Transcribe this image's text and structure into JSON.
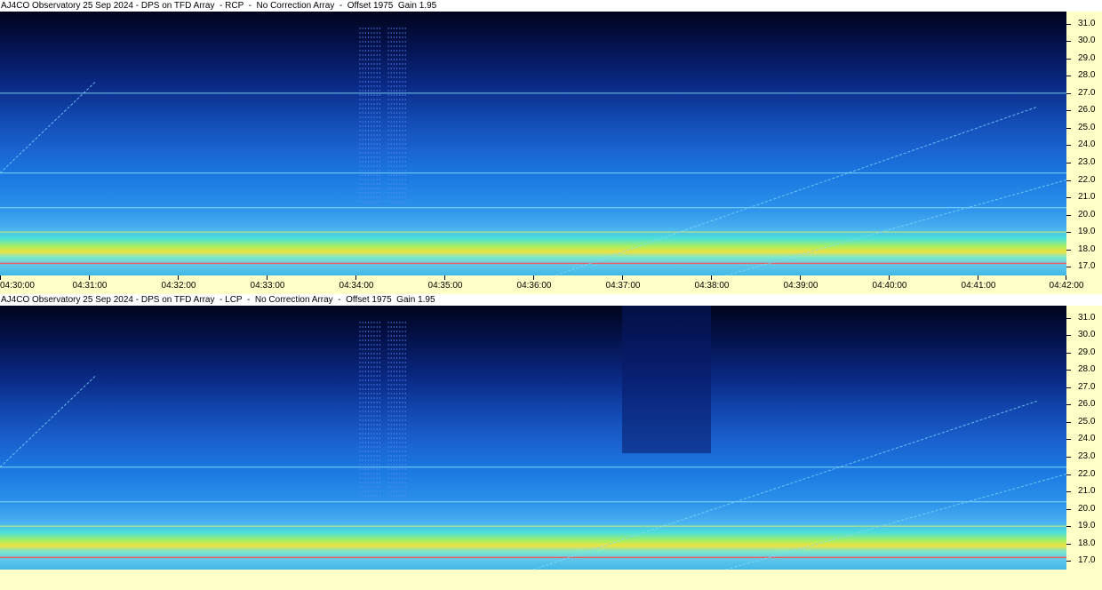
{
  "chart_data": [
    {
      "type": "heatmap",
      "title": "AJ4CO Observatory 25 Sep 2024 - DPS on TFD Array  - RCP  -  No Correction Array  -  Offset 1975  Gain 1.95",
      "polarization": "RCP",
      "xlabel": "",
      "ylabel": "",
      "x_ticks": [
        "04:30:00",
        "04:31:00",
        "04:32:00",
        "04:33:00",
        "04:34:00",
        "04:35:00",
        "04:36:00",
        "04:37:00",
        "04:38:00",
        "04:39:00",
        "04:40:00",
        "04:41:00",
        "04:42:00"
      ],
      "y_ticks": [
        "31.0",
        "30.0",
        "29.0",
        "28.0",
        "27.0",
        "26.0",
        "25.0",
        "24.0",
        "23.0",
        "22.0",
        "21.0",
        "20.0",
        "19.0",
        "18.0",
        "17.0"
      ],
      "xlim": [
        "04:30:00",
        "04:42:00"
      ],
      "ylim": [
        16.5,
        31.7
      ],
      "colormap": [
        "#01051c",
        "#0a2a86",
        "#1a62d0",
        "#2a90ea",
        "#4ce0d8",
        "#a8f060",
        "#f0e040"
      ],
      "features": {
        "burst_time_range": [
          "04:34:03",
          "04:34:35"
        ],
        "interference_lines": [
          22.4,
          20.4,
          19.0,
          17.2,
          27.0
        ],
        "drift_lines": [
          {
            "from": [
              "04:30:00",
              22.4
            ],
            "to": [
              "04:31:05",
              27.7
            ]
          },
          {
            "from": [
              "04:36:15",
              16.5
            ],
            "to": [
              "04:41:40",
              26.2
            ]
          },
          {
            "from": [
              "04:38:10",
              16.5
            ],
            "to": [
              "04:42:00",
              22.0
            ]
          }
        ]
      }
    },
    {
      "type": "heatmap",
      "title": "AJ4CO Observatory 25 Sep 2024 - DPS on TFD Array  - LCP  -  No Correction Array  -  Offset 1975  Gain 1.95",
      "polarization": "LCP",
      "xlabel": "",
      "ylabel": "",
      "x_ticks": [],
      "y_ticks": [
        "31.0",
        "30.0",
        "29.0",
        "28.0",
        "27.0",
        "26.0",
        "25.0",
        "24.0",
        "23.0",
        "22.0",
        "21.0",
        "20.0",
        "19.0",
        "18.0",
        "17.0"
      ],
      "xlim": [
        "04:30:00",
        "04:42:00"
      ],
      "ylim": [
        16.5,
        31.7
      ],
      "colormap": [
        "#01051c",
        "#0a2a86",
        "#1a62d0",
        "#2a90ea",
        "#4ce0d8",
        "#a8f060",
        "#f0e040"
      ],
      "features": {
        "burst_time_range": [
          "04:34:03",
          "04:34:35"
        ],
        "dark_block_time_range": [
          "04:37:00",
          "04:38:00"
        ],
        "interference_lines": [
          22.4,
          20.4,
          19.0,
          17.2
        ],
        "drift_lines": [
          {
            "from": [
              "04:30:00",
              22.4
            ],
            "to": [
              "04:31:05",
              27.7
            ]
          },
          {
            "from": [
              "04:36:00",
              16.5
            ],
            "to": [
              "04:41:40",
              26.2
            ]
          },
          {
            "from": [
              "04:38:10",
              16.5
            ],
            "to": [
              "04:42:00",
              22.0
            ]
          }
        ]
      }
    }
  ]
}
